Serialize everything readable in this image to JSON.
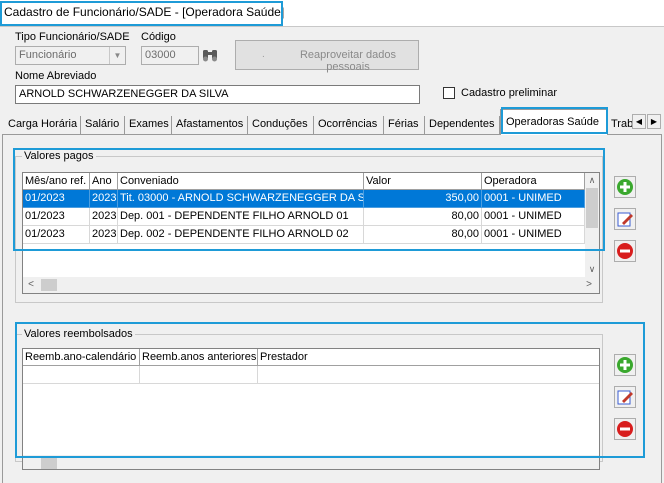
{
  "window": {
    "title": "Cadastro de Funcionário/SADE - [Operadora Saúde]"
  },
  "form": {
    "tipo_label": "Tipo Funcionário/SADE",
    "tipo_value": "Funcionário",
    "codigo_label": "Código",
    "codigo_value": "03000",
    "reaproveitar_label": "Reaproveitar dados pessoais",
    "nome_label": "Nome Abreviado",
    "nome_value": "ARNOLD SCHWARZENEGGER DA SILVA",
    "cadastro_preliminar_label": "Cadastro preliminar"
  },
  "tabs": [
    {
      "label": "Carga Horária"
    },
    {
      "label": "Salário"
    },
    {
      "label": "Exames"
    },
    {
      "label": "Afastamentos"
    },
    {
      "label": "Conduções"
    },
    {
      "label": "Ocorrências"
    },
    {
      "label": "Férias"
    },
    {
      "label": "Dependentes"
    },
    {
      "label": "Operadoras Saúde"
    },
    {
      "label": "Trab"
    }
  ],
  "valores_pagos": {
    "title": "Valores pagos",
    "columns": [
      "Mês/ano ref.",
      "Ano",
      "Conveniado",
      "Valor",
      "Operadora"
    ],
    "rows": [
      [
        "01/2023",
        "2023",
        "Tit. 03000 - ARNOLD SCHWARZENEGGER DA S",
        "350,00",
        "0001 - UNIMED"
      ],
      [
        "01/2023",
        "2023",
        "Dep.   001 - DEPENDENTE FILHO ARNOLD 01",
        "80,00",
        "0001 - UNIMED"
      ],
      [
        "01/2023",
        "2023",
        "Dep.   002 - DEPENDENTE FILHO ARNOLD 02",
        "80,00",
        "0001 - UNIMED"
      ]
    ]
  },
  "valores_reembolsados": {
    "title": "Valores reembolsados",
    "columns": [
      "Reemb.ano-calendário",
      "Reemb.anos anteriores",
      "Prestador"
    ]
  },
  "colors": {
    "highlight": "#1e9bd7",
    "selection": "#0078d7",
    "add": "#3aa82e",
    "delete": "#d81e1e"
  }
}
